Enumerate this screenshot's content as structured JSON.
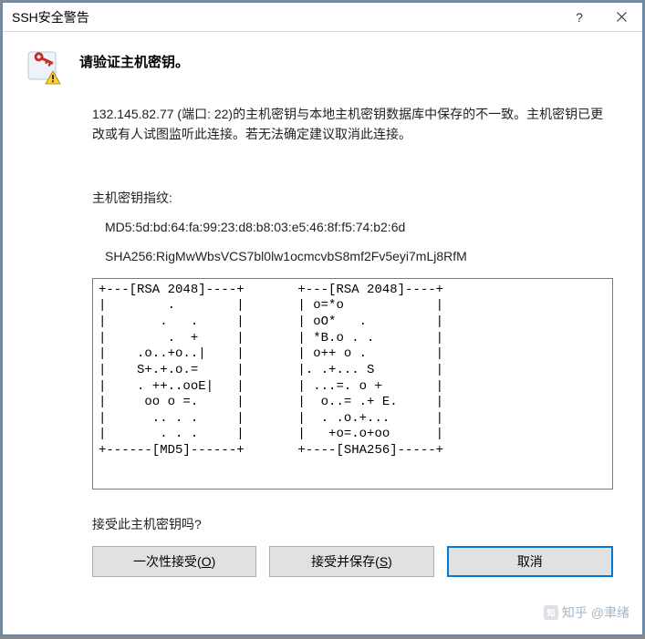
{
  "titlebar": {
    "title": "SSH安全警告"
  },
  "heading": "请验证主机密钥。",
  "message": "132.145.82.77 (端口: 22)的主机密钥与本地主机密钥数据库中保存的不一致。主机密钥已更改或有人试图监听此连接。若无法确定建议取消此连接。",
  "fingerprint": {
    "label": "主机密钥指纹:",
    "md5": "MD5:5d:bd:64:fa:99:23:d8:b8:03:e5:46:8f:f5:74:b2:6d",
    "sha256": "SHA256:RigMwWbsVCS7bl0lw1ocmcvbS8mf2Fv5eyi7mLj8RfM"
  },
  "randomart": "+---[RSA 2048]----+       +---[RSA 2048]----+\n|        .        |       | o=*o            |\n|       .   .     |       | oO*   .         |\n|        .  +     |       | *B.o . .        |\n|    .o..+o..|    |       | o++ o .         |\n|    S+.+.o.=     |       |. .+... S        |\n|    . ++..ooE|   |       | ...=. o +       |\n|     oo o =.     |       |  o..= .+ E.     |\n|      .. . .     |       |  . .o.+...      |\n|       . . .     |       |   +o=.o+oo      |\n+------[MD5]------+       +----[SHA256]-----+",
  "question": "接受此主机密钥吗?",
  "buttons": {
    "once_prefix": "一次性接受(",
    "once_hotkey": "O",
    "once_suffix": ")",
    "save_prefix": "接受并保存(",
    "save_hotkey": "S",
    "save_suffix": ")",
    "cancel": "取消"
  },
  "watermark": "知乎 @聿绪"
}
